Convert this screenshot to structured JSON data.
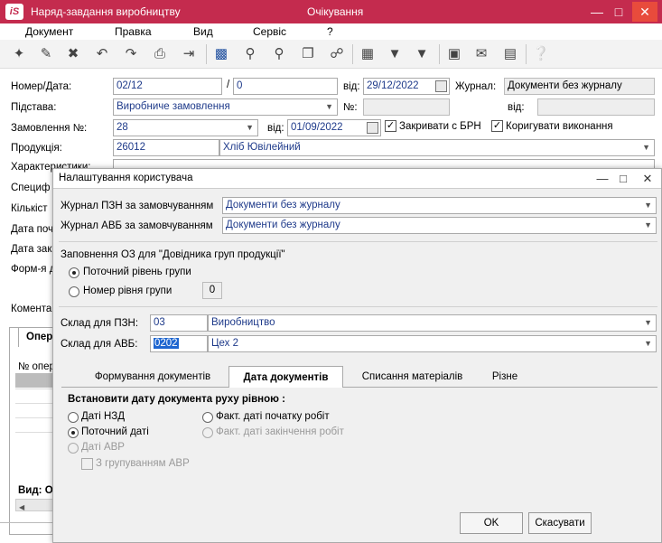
{
  "window": {
    "title": "Наряд-завдання виробництву",
    "status": "Очікування",
    "logo": "iS"
  },
  "menu": [
    "Документ",
    "Правка",
    "Вид",
    "Сервіс",
    "?"
  ],
  "form": {
    "number_date_label": "Номер/Дата:",
    "number": "02/12",
    "slash": "/",
    "subnumber": "0",
    "from_label": "від:",
    "date": "29/12/2022",
    "journal_label": "Журнал:",
    "journal_value": "Документи без журналу",
    "basis_label": "Підстава:",
    "basis_value": "Виробниче замовлення",
    "no_label": "№:",
    "order_label": "Замовлення №:",
    "order_value": "28",
    "order_date": "01/09/2022",
    "close_brn_label": "Закривати с БРН",
    "correct_label": "Коригувати виконання",
    "product_label": "Продукція:",
    "product_code": "26012",
    "product_name": "Хліб Ювілейний",
    "characteristics_label": "Характеристики:",
    "spec_label": "Специф",
    "qty_label": "Кількіст",
    "start_date_label": "Дата поч",
    "end_date_label": "Дата зак",
    "form_label": "Форм-я д",
    "comment_label": "Комента",
    "ops_tab": "Опер",
    "ops_col": "№ опер",
    "view_label": "Вид: О"
  },
  "dialog": {
    "title": "Налаштування користувача",
    "pzn_journal_label": "Журнал ПЗН за замовчуванням",
    "pzn_journal_value": "Документи без журналу",
    "avb_journal_label": "Журнал АВБ за замовчуванням",
    "avb_journal_value": "Документи без журналу",
    "oz_label": "Заповнення ОЗ для \"Довідника груп продукції\"",
    "radio_current_level": "Поточний рівень групи",
    "radio_level_number": "Номер рівня групи",
    "level_number_value": "0",
    "warehouse_pzn_label": "Склад для ПЗН:",
    "warehouse_pzn_code": "03",
    "warehouse_pzn_name": "Виробництво",
    "warehouse_avb_label": "Склад для АВБ:",
    "warehouse_avb_code": "0202",
    "warehouse_avb_name": "Цех 2",
    "tabs": [
      "Формування документів",
      "Дата документів",
      "Списання матеріалів",
      "Різне"
    ],
    "set_date_heading": "Встановити дату документа руху рівною :",
    "opt_nzd_date": "Даті НЗД",
    "opt_current_date": "Поточний даті",
    "opt_avr_date": "Даті АВР",
    "opt_avr_grouping": "З групуванням АВР",
    "opt_actual_start": "Факт. даті початку робіт",
    "opt_actual_end": "Факт. даті закінчення робіт",
    "ok_label": "OK",
    "cancel_label": "Скасувати"
  },
  "colors": {
    "titlebar": "#c42b4e",
    "close": "#e84b3c",
    "value_text": "#1e3a8a"
  }
}
